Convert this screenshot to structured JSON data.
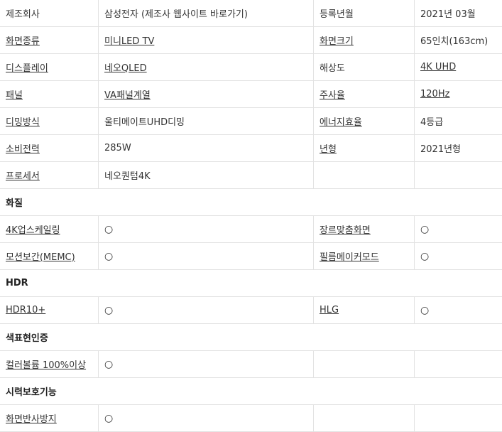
{
  "specs": {
    "rows": [
      {
        "type": "spec",
        "cells": [
          {
            "text": "제조회사",
            "link": false
          },
          {
            "text": "삼성전자 (제조사 웹사이트 바로가기)",
            "link": false
          },
          {
            "text": "등록년월",
            "link": false
          },
          {
            "text": "2021년 03월",
            "link": false
          }
        ]
      },
      {
        "type": "spec",
        "cells": [
          {
            "text": "화면종류",
            "link": true
          },
          {
            "text": "미니LED TV",
            "link": true
          },
          {
            "text": "화면크기",
            "link": true
          },
          {
            "text": "65인치(163cm)",
            "link": false
          }
        ]
      },
      {
        "type": "spec",
        "cells": [
          {
            "text": "디스플레이",
            "link": true
          },
          {
            "text": "네오QLED",
            "link": true
          },
          {
            "text": "해상도",
            "link": false
          },
          {
            "text": "4K UHD",
            "link": true
          }
        ]
      },
      {
        "type": "spec",
        "cells": [
          {
            "text": "패널",
            "link": true
          },
          {
            "text": "VA패널계열",
            "link": true
          },
          {
            "text": "주사율",
            "link": true
          },
          {
            "text": "120Hz",
            "link": true
          }
        ]
      },
      {
        "type": "spec",
        "cells": [
          {
            "text": "디밍방식",
            "link": true
          },
          {
            "text": "울티메이트UHD디밍",
            "link": false
          },
          {
            "text": "에너지효율",
            "link": true
          },
          {
            "text": "4등급",
            "link": false
          }
        ]
      },
      {
        "type": "spec",
        "cells": [
          {
            "text": "소비전력",
            "link": true
          },
          {
            "text": "285W",
            "link": false
          },
          {
            "text": "년형",
            "link": true
          },
          {
            "text": "2021년형",
            "link": false
          }
        ]
      },
      {
        "type": "spec",
        "cells": [
          {
            "text": "프로세서",
            "link": true
          },
          {
            "text": "네오퀀텀4K",
            "link": false
          },
          {
            "text": "",
            "link": false
          },
          {
            "text": "",
            "link": false
          }
        ]
      },
      {
        "type": "section",
        "title": "화질"
      },
      {
        "type": "spec",
        "cells": [
          {
            "text": "4K업스케일링",
            "link": true
          },
          {
            "text": "○",
            "link": false
          },
          {
            "text": "장르맞춤화면",
            "link": true
          },
          {
            "text": "○",
            "link": false
          }
        ]
      },
      {
        "type": "spec",
        "cells": [
          {
            "text": "모션보간(MEMC)",
            "link": true
          },
          {
            "text": "○",
            "link": false
          },
          {
            "text": "필름메이커모드",
            "link": true
          },
          {
            "text": "○",
            "link": false
          }
        ]
      },
      {
        "type": "section",
        "title": "HDR"
      },
      {
        "type": "spec",
        "cells": [
          {
            "text": "HDR10+",
            "link": true
          },
          {
            "text": "○",
            "link": false
          },
          {
            "text": "HLG",
            "link": true
          },
          {
            "text": "○",
            "link": false
          }
        ]
      },
      {
        "type": "section",
        "title": "색표현인증"
      },
      {
        "type": "spec",
        "cells": [
          {
            "text": "컬러볼륨 100%이상",
            "link": true
          },
          {
            "text": "○",
            "link": false
          },
          {
            "text": "",
            "link": false
          },
          {
            "text": "",
            "link": false
          }
        ]
      },
      {
        "type": "section",
        "title": "시력보호기능"
      },
      {
        "type": "spec",
        "cells": [
          {
            "text": "화면반사방지",
            "link": true
          },
          {
            "text": "○",
            "link": false
          },
          {
            "text": "",
            "link": false
          },
          {
            "text": "",
            "link": false
          }
        ]
      }
    ]
  }
}
